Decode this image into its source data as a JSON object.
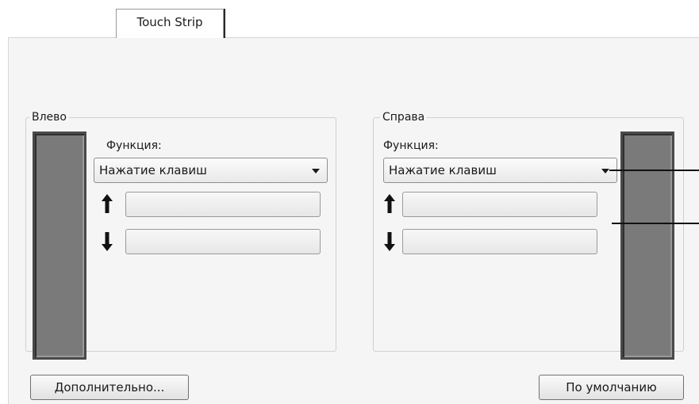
{
  "tabs": [
    {
      "label": "Touch Strip",
      "active": true
    }
  ],
  "left": {
    "title": "Влево",
    "function_label": "Функция:",
    "function_value": "Нажатие клавиш",
    "up_value": "",
    "down_value": ""
  },
  "right": {
    "title": "Справа",
    "function_label": "Функция:",
    "function_value": "Нажатие клавиш",
    "up_value": "",
    "down_value": ""
  },
  "buttons": {
    "advanced": "Дополнительно...",
    "defaults": "По умолчанию"
  },
  "icons": {
    "up": "arrow-up-icon",
    "down": "arrow-down-icon",
    "dropdown": "chevron-down-icon"
  },
  "colors": {
    "strip": "#7a7a7a",
    "panel": "#f5f5f5"
  }
}
